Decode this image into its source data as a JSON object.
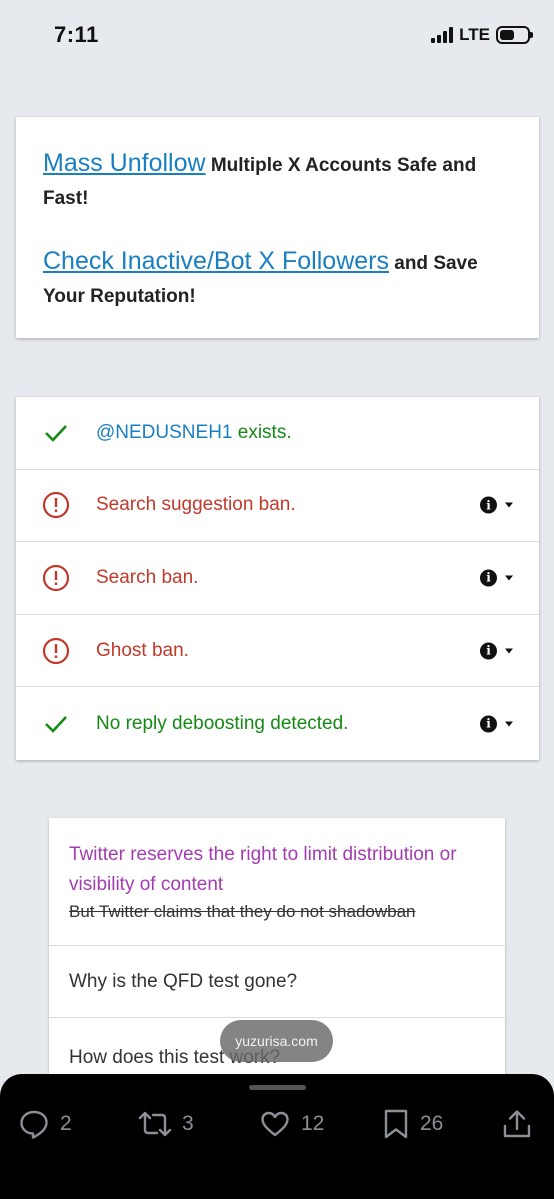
{
  "status_bar": {
    "time": "7:11",
    "network": "LTE",
    "battery_level": 0.55
  },
  "promo": {
    "line1_link": "Mass Unfollow",
    "line1_text": " Multiple X Accounts Safe and Fast!",
    "line2_link": "Check Inactive/Bot X Followers",
    "line2_text": " and Save Your Reputation!"
  },
  "results": {
    "handle": "@NEDUSNEH1",
    "exists_text": " exists.",
    "rows": [
      {
        "label": "Search suggestion ban.",
        "status": "fail"
      },
      {
        "label": "Search ban.",
        "status": "fail"
      },
      {
        "label": "Ghost ban.",
        "status": "fail"
      },
      {
        "label": "No reply deboosting detected.",
        "status": "pass"
      }
    ],
    "info_glyph": "i"
  },
  "faq": {
    "purple_text": "Twitter reserves the right to limit distribution or visibility of content",
    "strike_text": "But Twitter claims that they do not shadowban",
    "q1": "Why is the QFD test gone?",
    "q2": "How does this test work?"
  },
  "watermark": "yuzurisa.com",
  "actions": {
    "replies": "2",
    "reposts": "3",
    "likes": "12",
    "bookmarks": "26"
  },
  "colors": {
    "link_blue": "#1a7fc1",
    "pass_green": "#158a15",
    "fail_red": "#c0392b",
    "purple": "#a43cb2",
    "action_gray": "#8b9096"
  }
}
